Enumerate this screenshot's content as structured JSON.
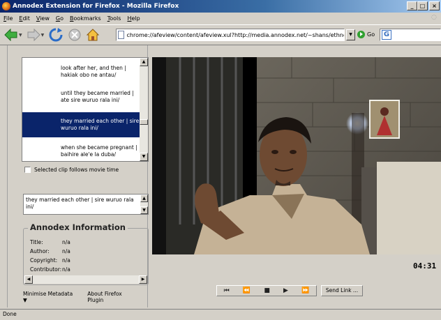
{
  "window": {
    "title": "Annodex Extension for Firefox - Mozilla Firefox"
  },
  "menubar": {
    "items": [
      {
        "label": "File",
        "mnemonic": "F",
        "rest": "ile"
      },
      {
        "label": "Edit",
        "mnemonic": "E",
        "rest": "dit"
      },
      {
        "label": "View",
        "mnemonic": "V",
        "rest": "iew"
      },
      {
        "label": "Go",
        "mnemonic": "G",
        "rest": "o"
      },
      {
        "label": "Bookmarks",
        "mnemonic": "B",
        "rest": "ookmarks"
      },
      {
        "label": "Tools",
        "mnemonic": "T",
        "rest": "ools"
      },
      {
        "label": "Help",
        "mnemonic": "H",
        "rest": "elp"
      }
    ]
  },
  "navbar": {
    "icons": [
      "back-icon",
      "forward-icon",
      "reload-icon",
      "stop-icon",
      "home-icon"
    ],
    "url": "chrome://afeview/content/afeview.xul?http://media.annodex.net/~shans/ethnoER_t",
    "go_label": "Go"
  },
  "clips": [
    {
      "text": "look after her, and then | hakiak obo ne antau/",
      "selected": false
    },
    {
      "text": "until they became married | ate sire wuruo rala ini/",
      "selected": false
    },
    {
      "text": "they married each other | sire wuruo rala ini/",
      "selected": true
    },
    {
      "text": "when she became pregnant | baihire ale'e la duba/",
      "selected": false
    }
  ],
  "follow_checkbox": {
    "label": "Selected clip follows movie time",
    "checked": false
  },
  "clip_text": "they married each other | sire wuruo rala ini/",
  "info": {
    "heading": "Annodex Information",
    "rows": [
      {
        "key": "Title:",
        "value": "n/a"
      },
      {
        "key": "Author:",
        "value": "n/a"
      },
      {
        "key": "Copyright:",
        "value": "n/a"
      },
      {
        "key": "Contributor:",
        "value": "n/a"
      }
    ]
  },
  "bottom_links": {
    "minimise": "Minimise Metadata ▼",
    "about": "About Firefox Plugin"
  },
  "player": {
    "time": "04:31",
    "controls": [
      "skip-back-icon",
      "rewind-icon",
      "stop-icon",
      "play-icon",
      "fast-forward-icon"
    ],
    "send_link": "Send Link ..."
  },
  "status": "Done",
  "colors": {
    "selection": "#0a246a",
    "chrome": "#d4d0c8",
    "title_gradient_start": "#0a246a"
  }
}
